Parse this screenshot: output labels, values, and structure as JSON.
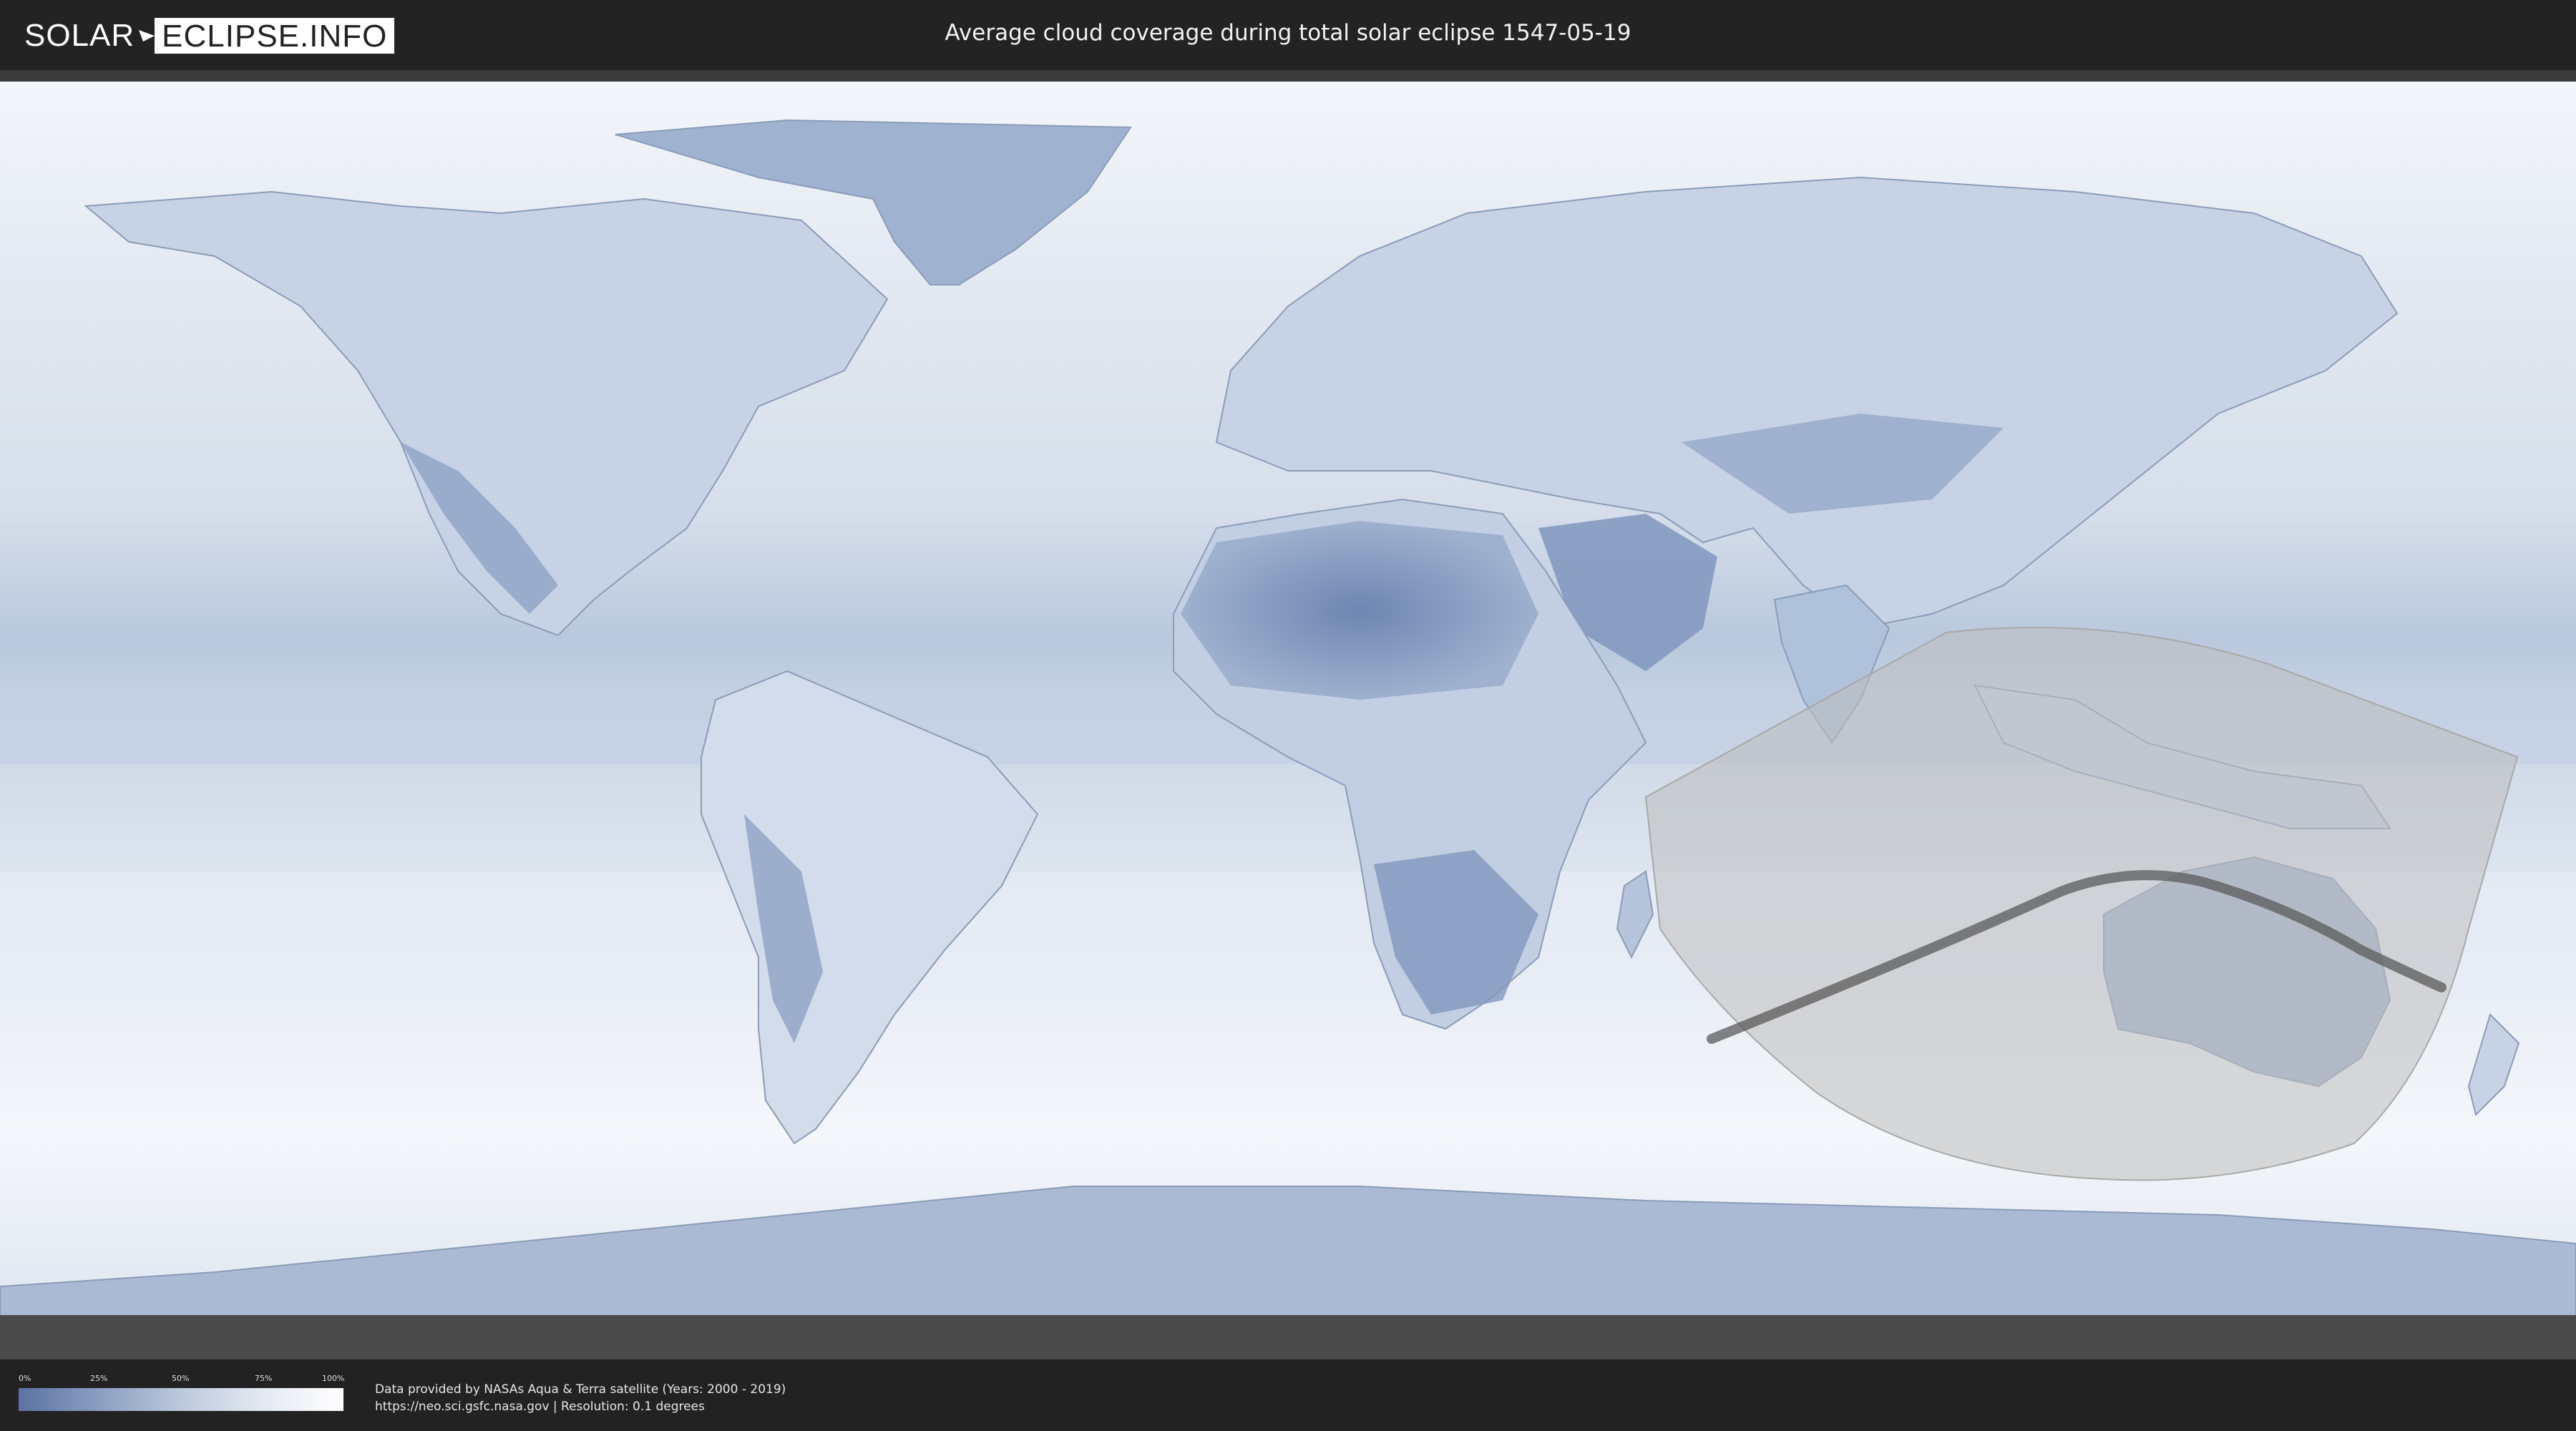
{
  "header": {
    "logo_left": "SOLAR",
    "logo_right": "ECLIPSE.INFO",
    "title": "Average cloud coverage during total solar eclipse 1547-05-19"
  },
  "legend": {
    "ticks": [
      "0%",
      "25%",
      "50%",
      "75%",
      "100%"
    ],
    "low_color": "#5a73a3",
    "high_color": "#ffffff"
  },
  "credits": {
    "line1": "Data provided by NASAs Aqua & Terra satellite (Years: 2000 - 2019)",
    "line2": "https://neo.sci.gsfc.nasa.gov | Resolution: 0.1 degrees"
  },
  "colors": {
    "ocean_cloud": "#dfe7f1",
    "land_clear": "#6f88b3",
    "eclipse_zone": "#b8b8b8",
    "central_line": "#555555"
  }
}
